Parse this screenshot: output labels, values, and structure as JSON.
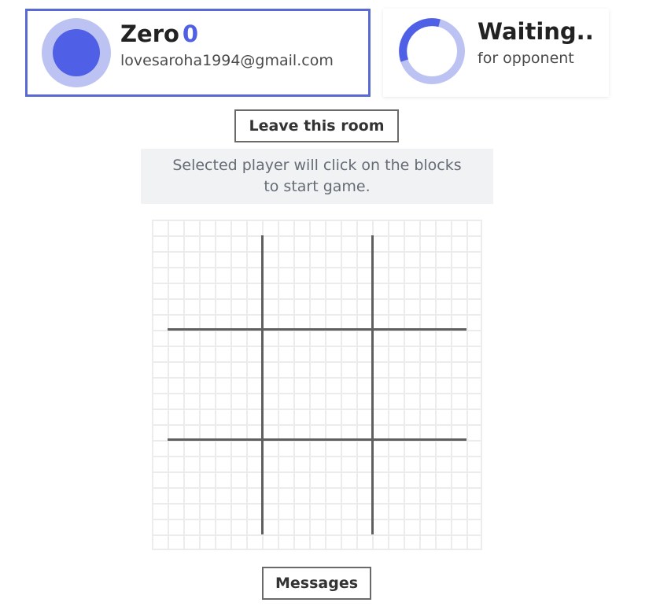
{
  "player": {
    "name": "Zero",
    "score": "0",
    "email": "lovesaroha1994@gmail.com",
    "accent": "#4f5fe6",
    "ring": "#bcc3f3"
  },
  "opponent": {
    "status": "Waiting..",
    "subtitle": "for opponent"
  },
  "actions": {
    "leave_label": "Leave this room",
    "messages_label": "Messages"
  },
  "info": {
    "line1": "Selected player will click on the blocks",
    "line2": "to start game."
  },
  "board": {
    "rows": 3,
    "cols": 3,
    "cells": [
      "",
      "",
      "",
      "",
      "",
      "",
      "",
      "",
      ""
    ]
  }
}
